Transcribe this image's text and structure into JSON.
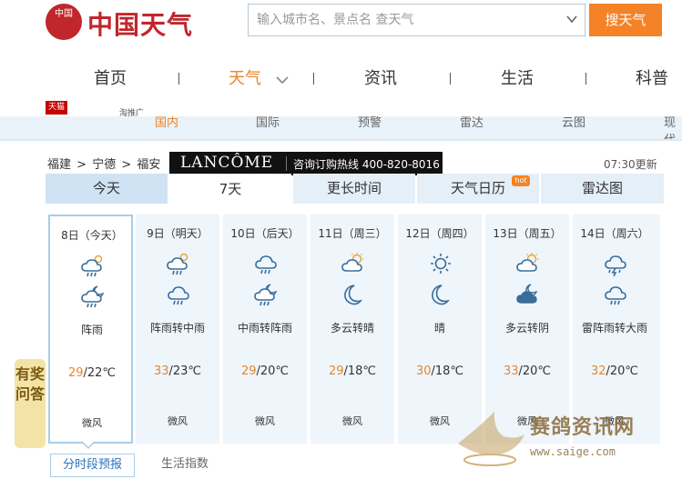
{
  "header": {
    "logo_seal": "中国",
    "logo_text": "中国天气",
    "search_placeholder": "输入城市名、景点名 查天气",
    "search_button": "搜天气"
  },
  "nav": {
    "items": [
      {
        "label": "首页",
        "active": false
      },
      {
        "label": "天气",
        "active": true
      },
      {
        "label": "资讯",
        "active": false
      },
      {
        "label": "生活",
        "active": false
      },
      {
        "label": "科普",
        "active": false
      }
    ]
  },
  "ads": {
    "tmall": "天猫",
    "taobao": "淘推广"
  },
  "subnav": {
    "items": [
      {
        "label": "国内",
        "active": true
      },
      {
        "label": "国际",
        "active": false
      },
      {
        "label": "预警",
        "active": false
      },
      {
        "label": "雷达",
        "active": false
      },
      {
        "label": "云图",
        "active": false
      },
      {
        "label": "现代",
        "active": false
      }
    ]
  },
  "breadcrumb": {
    "items": [
      "福建",
      ">",
      "宁德",
      ">",
      "福安"
    ]
  },
  "lancome_ad": {
    "brand": "LANCÔME",
    "hotline": "咨询订购热线 400-820-8016"
  },
  "update_time": "07:30更新",
  "tabs": [
    {
      "label": "今天",
      "active": false
    },
    {
      "label": "7天",
      "active": true
    },
    {
      "label": "更长时间",
      "active": false
    },
    {
      "label": "天气日历",
      "active": false,
      "badge": "hot"
    },
    {
      "label": "雷达图",
      "active": false
    }
  ],
  "forecast": [
    {
      "date": "8日（今天）",
      "icon1": "shower-icon",
      "icon2": "night-shower-icon",
      "weather": "阵雨",
      "high": "29",
      "low": "/22℃",
      "wind": "微风",
      "today": true
    },
    {
      "date": "9日（明天）",
      "icon1": "shower-icon",
      "icon2": "rain-icon",
      "weather": "阵雨转中雨",
      "high": "33",
      "low": "/23℃",
      "wind": "微风",
      "today": false
    },
    {
      "date": "10日（后天）",
      "icon1": "rain-icon",
      "icon2": "night-shower-icon",
      "weather": "中雨转阵雨",
      "high": "29",
      "low": "/20℃",
      "wind": "微风",
      "today": false
    },
    {
      "date": "11日（周三）",
      "icon1": "partly-cloudy-icon",
      "icon2": "moon-icon",
      "weather": "多云转晴",
      "high": "29",
      "low": "/18℃",
      "wind": "微风",
      "today": false
    },
    {
      "date": "12日（周四）",
      "icon1": "sun-icon",
      "icon2": "moon-icon",
      "weather": "晴",
      "high": "30",
      "low": "/18℃",
      "wind": "微风",
      "today": false
    },
    {
      "date": "13日（周五）",
      "icon1": "partly-cloudy-icon",
      "icon2": "night-cloudy-icon",
      "weather": "多云转阴",
      "high": "33",
      "low": "/20℃",
      "wind": "微风",
      "today": false
    },
    {
      "date": "14日（周六）",
      "icon1": "thunder-rain-icon",
      "icon2": "rain-icon",
      "weather": "雷阵雨转大雨",
      "high": "32",
      "low": "/20℃",
      "wind": "微风",
      "today": false
    }
  ],
  "quiz": "有奖问答",
  "bottom_tabs": {
    "active": "分时段预报",
    "other": "生活指数"
  },
  "watermark": {
    "text": "赛鸽资讯网",
    "url": "www.saige.com"
  },
  "colors": {
    "brand_red": "#c0262c",
    "accent_orange": "#f48327",
    "high_temp": "#e8862a",
    "tab_bg": "#e5eff8",
    "icon_stroke": "#3a6e9a"
  }
}
